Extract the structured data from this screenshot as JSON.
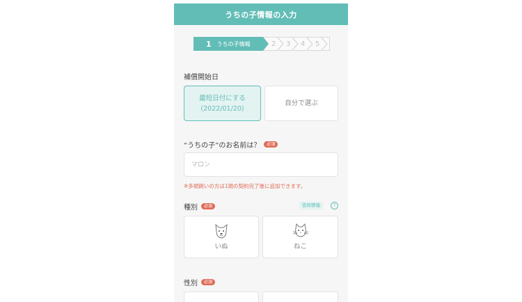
{
  "header": {
    "title": "うちの子情報の入力"
  },
  "steps": {
    "active": {
      "number": "1",
      "label": "うちの子情報"
    },
    "rest": [
      "2",
      "3",
      "4",
      "5"
    ]
  },
  "coverage_start": {
    "label": "補償開始日",
    "options": [
      {
        "line1": "最短日付にする",
        "line2": "(2022/01/20)",
        "selected": true
      },
      {
        "line1": "自分で選ぶ",
        "selected": false
      }
    ]
  },
  "pet_name": {
    "label": "“うちの子”のお名前は？",
    "required_badge": "必須",
    "placeholder": "マロン",
    "note": "※多頭飼いの方は1頭の契約完了後に追加できます。"
  },
  "species": {
    "label": "種別",
    "required_badge": "必須",
    "disclosure_badge": "告知情報",
    "help_symbol": "?",
    "options": [
      {
        "label": "いぬ",
        "icon": "dog-icon"
      },
      {
        "label": "ねこ",
        "icon": "cat-icon"
      }
    ]
  },
  "sex": {
    "label": "性別",
    "required_badge": "必須"
  },
  "colors": {
    "primary": "#62bdb7",
    "primary_light": "#e3f3f1",
    "required": "#e06c57"
  }
}
